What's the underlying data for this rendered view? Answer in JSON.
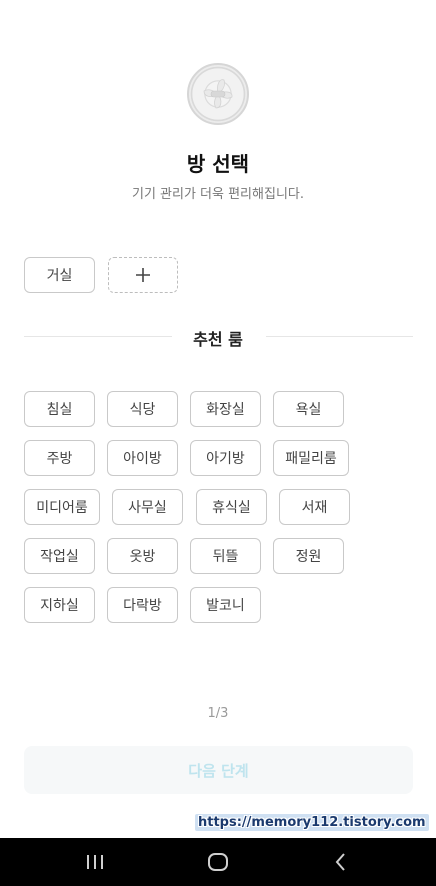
{
  "header": {
    "device_image": "ceiling-fan-device-icon",
    "title": "방 선택",
    "subtitle": "기기 관리가 더욱 편리해집니다."
  },
  "selected_rooms": [
    "거실"
  ],
  "add_room_icon": "plus-icon",
  "recommended": {
    "title": "추천 룸",
    "rooms": [
      [
        "침실",
        "식당",
        "화장실",
        "욕실"
      ],
      [
        "주방",
        "아이방",
        "아기방",
        "패밀리룸"
      ],
      [
        "미디어룸",
        "사무실",
        "휴식실",
        "서재"
      ],
      [
        "작업실",
        "옷방",
        "뒤뜰",
        "정원"
      ],
      [
        "지하실",
        "다락방",
        "발코니"
      ]
    ]
  },
  "pager": "1/3",
  "next_button": "다음 단계",
  "watermark": "https://memory112.tistory.com",
  "navbar": {
    "recents_icon": "recents-icon",
    "home_icon": "home-icon",
    "back_icon": "back-icon"
  },
  "colors": {
    "next_button_text": "#bfe4ee",
    "next_button_bg": "#f6f8f9",
    "navbar_bg": "#000000"
  }
}
